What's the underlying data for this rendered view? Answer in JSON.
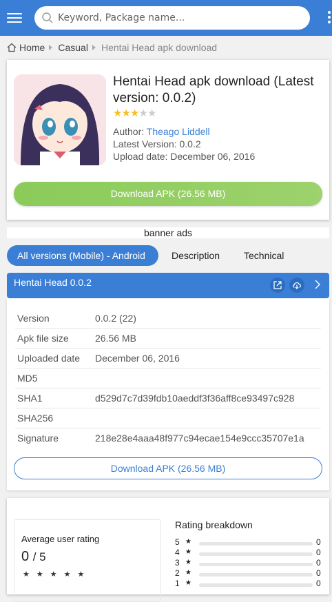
{
  "header": {
    "search_placeholder": "Keyword, Package name..."
  },
  "breadcrumb": {
    "home": "Home",
    "category": "Casual",
    "current": "Hentai Head apk download"
  },
  "app": {
    "title": "Hentai Head apk download (Latest version: 0.0.2)",
    "rating_stars": 3,
    "author_label": "Author:",
    "author_name": "Theago Liddell",
    "latest_version_text": "Latest Version: 0.0.2",
    "upload_date_text": "Upload date: December 06, 2016",
    "download_label": "Download APK (26.56 MB)"
  },
  "banner": "banner ads",
  "tabs": [
    {
      "label": "All versions (Mobile) - Android"
    },
    {
      "label": "Description"
    },
    {
      "label": "Technical"
    }
  ],
  "version_panel": {
    "title": "Hentai Head 0.0.2",
    "rows": [
      {
        "key": "Version",
        "value": "0.0.2 (22)"
      },
      {
        "key": "Apk file size",
        "value": "26.56 MB"
      },
      {
        "key": "Uploaded date",
        "value": "December 06, 2016"
      },
      {
        "key": "MD5",
        "value": ""
      },
      {
        "key": "SHA1",
        "value": "d529d7c7d39fdb10aeddf3f36aff8ce93497c928"
      },
      {
        "key": "SHA256",
        "value": ""
      },
      {
        "key": "Signature",
        "value": "218e28e4aaa48f977c94ecae154e9ccc35707e1a"
      }
    ],
    "download_label": "Download APK (26.56 MB)"
  },
  "rating": {
    "avg_label": "Average user rating",
    "avg_value": "0",
    "avg_max": "/ 5",
    "breakdown_title": "Rating breakdown",
    "breakdown": [
      {
        "stars": "5",
        "count": "0"
      },
      {
        "stars": "4",
        "count": "0"
      },
      {
        "stars": "3",
        "count": "0"
      },
      {
        "stars": "2",
        "count": "0"
      },
      {
        "stars": "1",
        "count": "0"
      }
    ]
  },
  "colors": {
    "primary": "#3a7fd5",
    "download_green": "#8bcb5a",
    "star_gold": "#f6bf26"
  }
}
